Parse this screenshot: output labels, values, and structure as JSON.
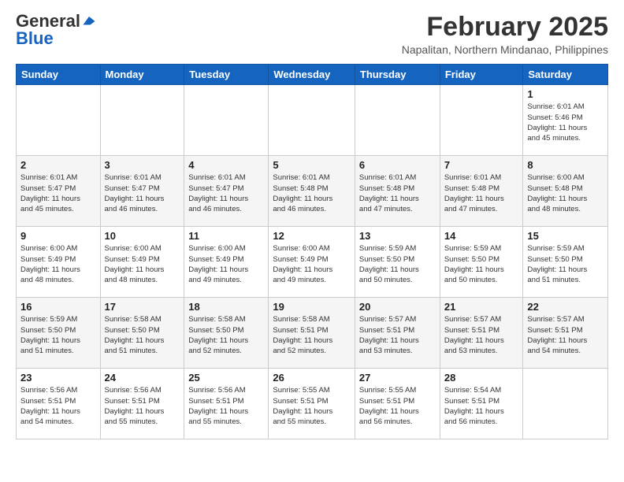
{
  "header": {
    "logo_general": "General",
    "logo_blue": "Blue",
    "month_year": "February 2025",
    "location": "Napalitan, Northern Mindanao, Philippines"
  },
  "days_of_week": [
    "Sunday",
    "Monday",
    "Tuesday",
    "Wednesday",
    "Thursday",
    "Friday",
    "Saturday"
  ],
  "weeks": [
    [
      {
        "day": "",
        "info": ""
      },
      {
        "day": "",
        "info": ""
      },
      {
        "day": "",
        "info": ""
      },
      {
        "day": "",
        "info": ""
      },
      {
        "day": "",
        "info": ""
      },
      {
        "day": "",
        "info": ""
      },
      {
        "day": "1",
        "info": "Sunrise: 6:01 AM\nSunset: 5:46 PM\nDaylight: 11 hours\nand 45 minutes."
      }
    ],
    [
      {
        "day": "2",
        "info": "Sunrise: 6:01 AM\nSunset: 5:47 PM\nDaylight: 11 hours\nand 45 minutes."
      },
      {
        "day": "3",
        "info": "Sunrise: 6:01 AM\nSunset: 5:47 PM\nDaylight: 11 hours\nand 46 minutes."
      },
      {
        "day": "4",
        "info": "Sunrise: 6:01 AM\nSunset: 5:47 PM\nDaylight: 11 hours\nand 46 minutes."
      },
      {
        "day": "5",
        "info": "Sunrise: 6:01 AM\nSunset: 5:48 PM\nDaylight: 11 hours\nand 46 minutes."
      },
      {
        "day": "6",
        "info": "Sunrise: 6:01 AM\nSunset: 5:48 PM\nDaylight: 11 hours\nand 47 minutes."
      },
      {
        "day": "7",
        "info": "Sunrise: 6:01 AM\nSunset: 5:48 PM\nDaylight: 11 hours\nand 47 minutes."
      },
      {
        "day": "8",
        "info": "Sunrise: 6:00 AM\nSunset: 5:48 PM\nDaylight: 11 hours\nand 48 minutes."
      }
    ],
    [
      {
        "day": "9",
        "info": "Sunrise: 6:00 AM\nSunset: 5:49 PM\nDaylight: 11 hours\nand 48 minutes."
      },
      {
        "day": "10",
        "info": "Sunrise: 6:00 AM\nSunset: 5:49 PM\nDaylight: 11 hours\nand 48 minutes."
      },
      {
        "day": "11",
        "info": "Sunrise: 6:00 AM\nSunset: 5:49 PM\nDaylight: 11 hours\nand 49 minutes."
      },
      {
        "day": "12",
        "info": "Sunrise: 6:00 AM\nSunset: 5:49 PM\nDaylight: 11 hours\nand 49 minutes."
      },
      {
        "day": "13",
        "info": "Sunrise: 5:59 AM\nSunset: 5:50 PM\nDaylight: 11 hours\nand 50 minutes."
      },
      {
        "day": "14",
        "info": "Sunrise: 5:59 AM\nSunset: 5:50 PM\nDaylight: 11 hours\nand 50 minutes."
      },
      {
        "day": "15",
        "info": "Sunrise: 5:59 AM\nSunset: 5:50 PM\nDaylight: 11 hours\nand 51 minutes."
      }
    ],
    [
      {
        "day": "16",
        "info": "Sunrise: 5:59 AM\nSunset: 5:50 PM\nDaylight: 11 hours\nand 51 minutes."
      },
      {
        "day": "17",
        "info": "Sunrise: 5:58 AM\nSunset: 5:50 PM\nDaylight: 11 hours\nand 51 minutes."
      },
      {
        "day": "18",
        "info": "Sunrise: 5:58 AM\nSunset: 5:50 PM\nDaylight: 11 hours\nand 52 minutes."
      },
      {
        "day": "19",
        "info": "Sunrise: 5:58 AM\nSunset: 5:51 PM\nDaylight: 11 hours\nand 52 minutes."
      },
      {
        "day": "20",
        "info": "Sunrise: 5:57 AM\nSunset: 5:51 PM\nDaylight: 11 hours\nand 53 minutes."
      },
      {
        "day": "21",
        "info": "Sunrise: 5:57 AM\nSunset: 5:51 PM\nDaylight: 11 hours\nand 53 minutes."
      },
      {
        "day": "22",
        "info": "Sunrise: 5:57 AM\nSunset: 5:51 PM\nDaylight: 11 hours\nand 54 minutes."
      }
    ],
    [
      {
        "day": "23",
        "info": "Sunrise: 5:56 AM\nSunset: 5:51 PM\nDaylight: 11 hours\nand 54 minutes."
      },
      {
        "day": "24",
        "info": "Sunrise: 5:56 AM\nSunset: 5:51 PM\nDaylight: 11 hours\nand 55 minutes."
      },
      {
        "day": "25",
        "info": "Sunrise: 5:56 AM\nSunset: 5:51 PM\nDaylight: 11 hours\nand 55 minutes."
      },
      {
        "day": "26",
        "info": "Sunrise: 5:55 AM\nSunset: 5:51 PM\nDaylight: 11 hours\nand 55 minutes."
      },
      {
        "day": "27",
        "info": "Sunrise: 5:55 AM\nSunset: 5:51 PM\nDaylight: 11 hours\nand 56 minutes."
      },
      {
        "day": "28",
        "info": "Sunrise: 5:54 AM\nSunset: 5:51 PM\nDaylight: 11 hours\nand 56 minutes."
      },
      {
        "day": "",
        "info": ""
      }
    ]
  ]
}
